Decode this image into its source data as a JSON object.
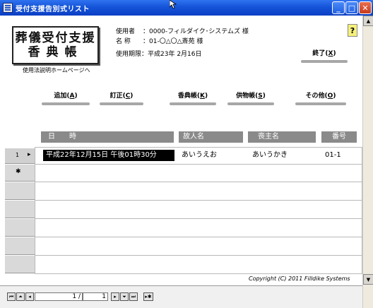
{
  "window": {
    "title": "受付支援告別式リスト",
    "min_glyph": "_",
    "max_glyph": "□",
    "close_glyph": "✕"
  },
  "logo": {
    "line1": "葬儀受付支援",
    "line2": "香典帳"
  },
  "home_link": "使用法説明ホームページへ",
  "user_info": {
    "user_label": "使用者",
    "user_value": "：0000-フィルダイク･システムズ 様",
    "name_label": "名  称",
    "name_value": "：01-〇△〇△斎苑 様",
    "expiry": "使用期限：平成23年 2月16日"
  },
  "help_label": "?",
  "buttons": {
    "exit": {
      "text": "終了(",
      "key": "X",
      "end": ")"
    },
    "add": {
      "text": "追加(",
      "key": "A",
      "end": ")"
    },
    "edit": {
      "text": "訂正(",
      "key": "C",
      "end": ")"
    },
    "koden": {
      "text": "香典帳(",
      "key": "K",
      "end": ")"
    },
    "offering": {
      "text": "供物帳(",
      "key": "S",
      "end": ")"
    },
    "other": {
      "text": "その他(",
      "key": "O",
      "end": ")"
    }
  },
  "grid": {
    "headers": {
      "datetime": "日　　時",
      "deceased": "故人名",
      "chief": "喪主名",
      "number": "番号"
    },
    "rows": [
      {
        "row_no": "1",
        "marker": "▸",
        "datetime": "平成22年12月15日 午後01時30分",
        "deceased": "あいうえお",
        "chief": "あいうかき",
        "number": "01-1"
      }
    ],
    "new_row_marker": "✱"
  },
  "copyright": "Copyright (C) 2011 Filldike Systems",
  "nav": {
    "first": "⏮",
    "prev_page": "⏶",
    "prev": "◂",
    "current": "1 /",
    "total": "1",
    "next": "▸",
    "next_page": "⏷",
    "last": "⏭",
    "new": "▸✱"
  },
  "scroll": {
    "up": "▲",
    "down": "▼"
  }
}
